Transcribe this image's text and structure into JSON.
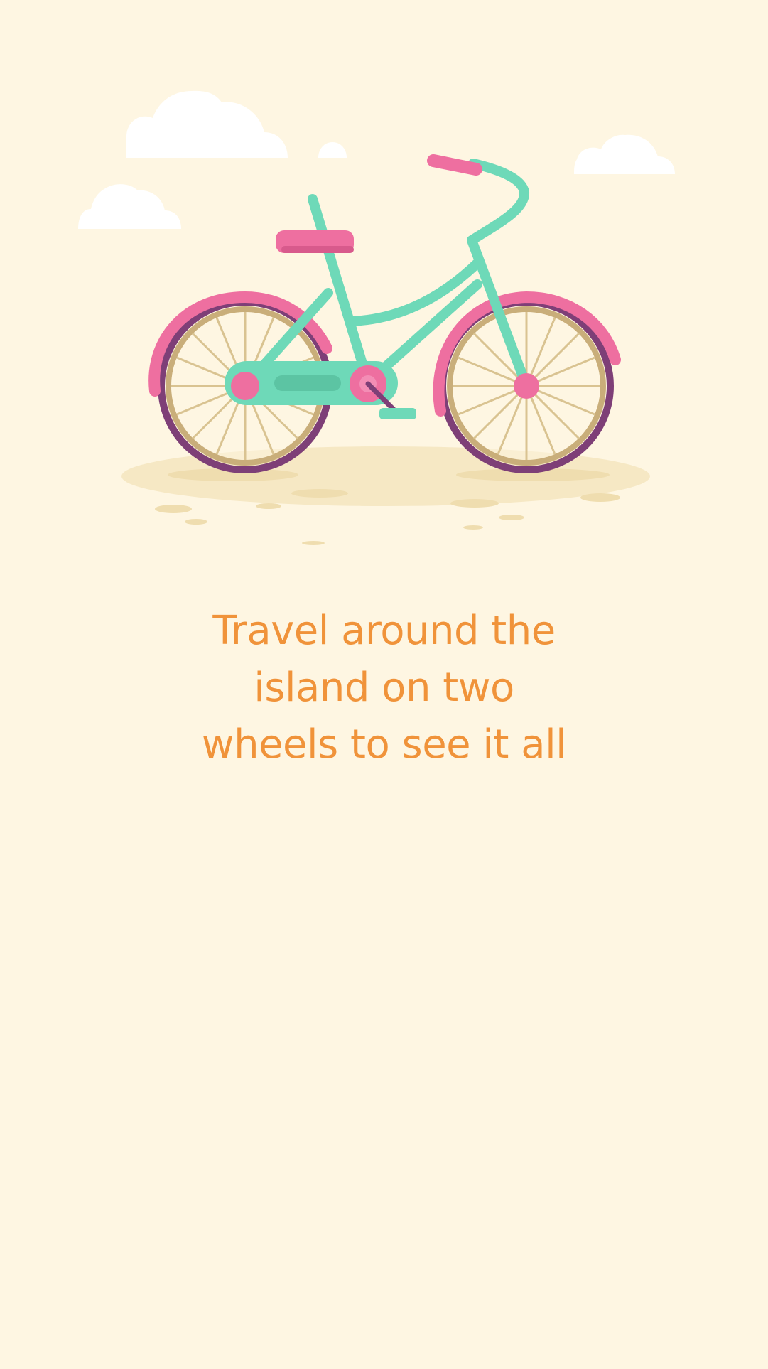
{
  "onboarding": {
    "illustration_icon": "bicycle-icon",
    "caption_lines": [
      "Travel around the",
      "island on two",
      "wheels to see it all"
    ]
  },
  "colors": {
    "background": "#FEF6E2",
    "caption_text": "#F0933A",
    "frame": "#6ED9B8",
    "accent_pink": "#EE6FA0",
    "tire": "#7E3F77",
    "rim": "#C9AE7A",
    "ground": "#F6E7C4",
    "cloud": "#FFFFFF"
  }
}
